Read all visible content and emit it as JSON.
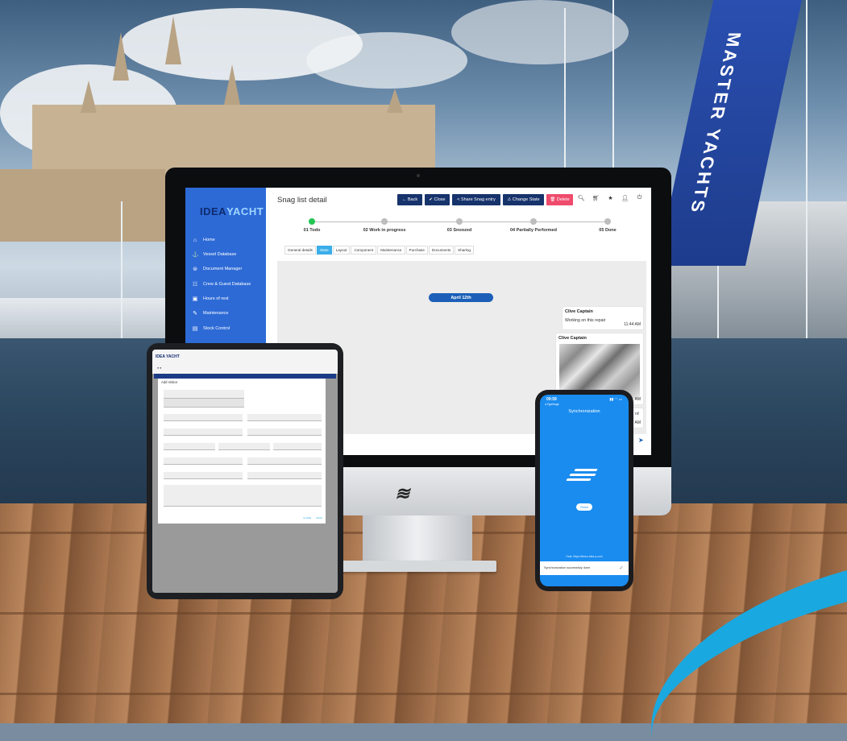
{
  "desktop": {
    "brand": {
      "idea": "IDEA",
      "yacht": "YACHT"
    },
    "page_title": "Snag list detail",
    "toolbar": {
      "back": "← Back",
      "close": "✔ Close",
      "share": "< Share Snag entry",
      "change_state": "⚠ Change State",
      "delete": "🗑 Delete"
    },
    "toolbar_icons": [
      "search-icon",
      "cart-icon",
      "star-icon",
      "user-icon",
      "power-icon"
    ],
    "sidebar": [
      {
        "icon": "⌂",
        "label": "Home"
      },
      {
        "icon": "⚓",
        "label": "Vessel Database"
      },
      {
        "icon": "⊜",
        "label": "Document Manager"
      },
      {
        "icon": "☷",
        "label": "Crew & Guest Database"
      },
      {
        "icon": "▣",
        "label": "Hours of rest"
      },
      {
        "icon": "✎",
        "label": "Maintenance"
      },
      {
        "icon": "▤",
        "label": "Stock Control"
      }
    ],
    "steps": [
      {
        "label": "01 Todo",
        "active": true
      },
      {
        "label": "02 Work in progress",
        "active": false
      },
      {
        "label": "03 Snoozed",
        "active": false
      },
      {
        "label": "04 Partially Performed",
        "active": false
      },
      {
        "label": "05 Done",
        "active": false
      }
    ],
    "tabs": [
      "General details",
      "State",
      "Layout",
      "Component",
      "Maintenance",
      "Purchase",
      "Documents",
      "Sharing"
    ],
    "selected_tab": "State",
    "chat": {
      "date": "April 12th",
      "messages": [
        {
          "author": "Clive Captain",
          "text": "Working on this repair",
          "time": "11:44 AM"
        },
        {
          "author": "Clive Captain",
          "text": "",
          "time": "AM"
        }
      ],
      "partial_text": "rd",
      "partial_time": "AM"
    }
  },
  "tablet": {
    "brand": "IDEA YACHT",
    "dialog_title": "Add Visitor",
    "actions": [
      "CLOSE",
      "SAVE"
    ]
  },
  "phone": {
    "time": "09:59",
    "back": "◂ Typeforge",
    "title": "Synchronization",
    "button": "Finish",
    "host": "Host: https://demo.idea-a.com",
    "snackbar": "Synchronization successfuly done",
    "check": "✓"
  },
  "scene": {
    "banner_text": "MASTER YACHTS",
    "colors": {
      "accent": "#2d6ad6",
      "navy": "#17336c",
      "delete": "#ef4b6c",
      "active_step": "#23c653",
      "swoosh": "#1aa8e0"
    }
  }
}
